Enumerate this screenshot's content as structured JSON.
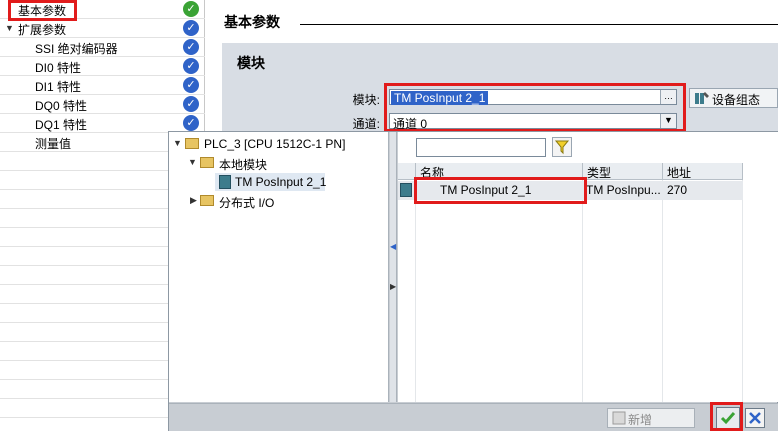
{
  "nav": {
    "items": [
      {
        "label": "基本参数",
        "level": 0,
        "status": "green"
      },
      {
        "label": "扩展参数",
        "level": 0,
        "status": "blue",
        "expanded": true
      },
      {
        "label": "SSI 绝对编码器",
        "level": 1,
        "status": "blue"
      },
      {
        "label": "DI0 特性",
        "level": 1,
        "status": "blue"
      },
      {
        "label": "DI1 特性",
        "level": 1,
        "status": "blue"
      },
      {
        "label": "DQ0 特性",
        "level": 1,
        "status": "blue"
      },
      {
        "label": "DQ1 特性",
        "level": 1,
        "status": "blue"
      },
      {
        "label": "测量值",
        "level": 1,
        "status": "blue"
      }
    ]
  },
  "main": {
    "section_title": "基本参数",
    "panel_title": "模块",
    "module_label": "模块:",
    "module_value": "TM PosInput 2_1",
    "channel_label": "通道:",
    "channel_value": "通道 0",
    "device_config_label": "设备组态"
  },
  "popup": {
    "tree": [
      {
        "label": "PLC_3 [CPU 1512C-1 PN]",
        "level": 0,
        "icon": "folder",
        "expanded": true
      },
      {
        "label": "本地模块",
        "level": 1,
        "icon": "folder",
        "expanded": true
      },
      {
        "label": "TM PosInput 2_1",
        "level": 2,
        "icon": "module",
        "selected": true
      },
      {
        "label": "分布式 I/O",
        "level": 1,
        "icon": "folder",
        "expanded": false
      }
    ],
    "filter_value": "",
    "columns": [
      "名称",
      "类型",
      "地址"
    ],
    "rows": [
      {
        "name": "TM PosInput 2_1",
        "type": "TM PosInpu...",
        "address": "270"
      }
    ],
    "new_button_label": "新增"
  },
  "colors": {
    "highlight_red": "#e11b1b",
    "ok_green": "#3aa335",
    "check_blue": "#2f63c8",
    "panel_gray": "#d8dde4"
  }
}
